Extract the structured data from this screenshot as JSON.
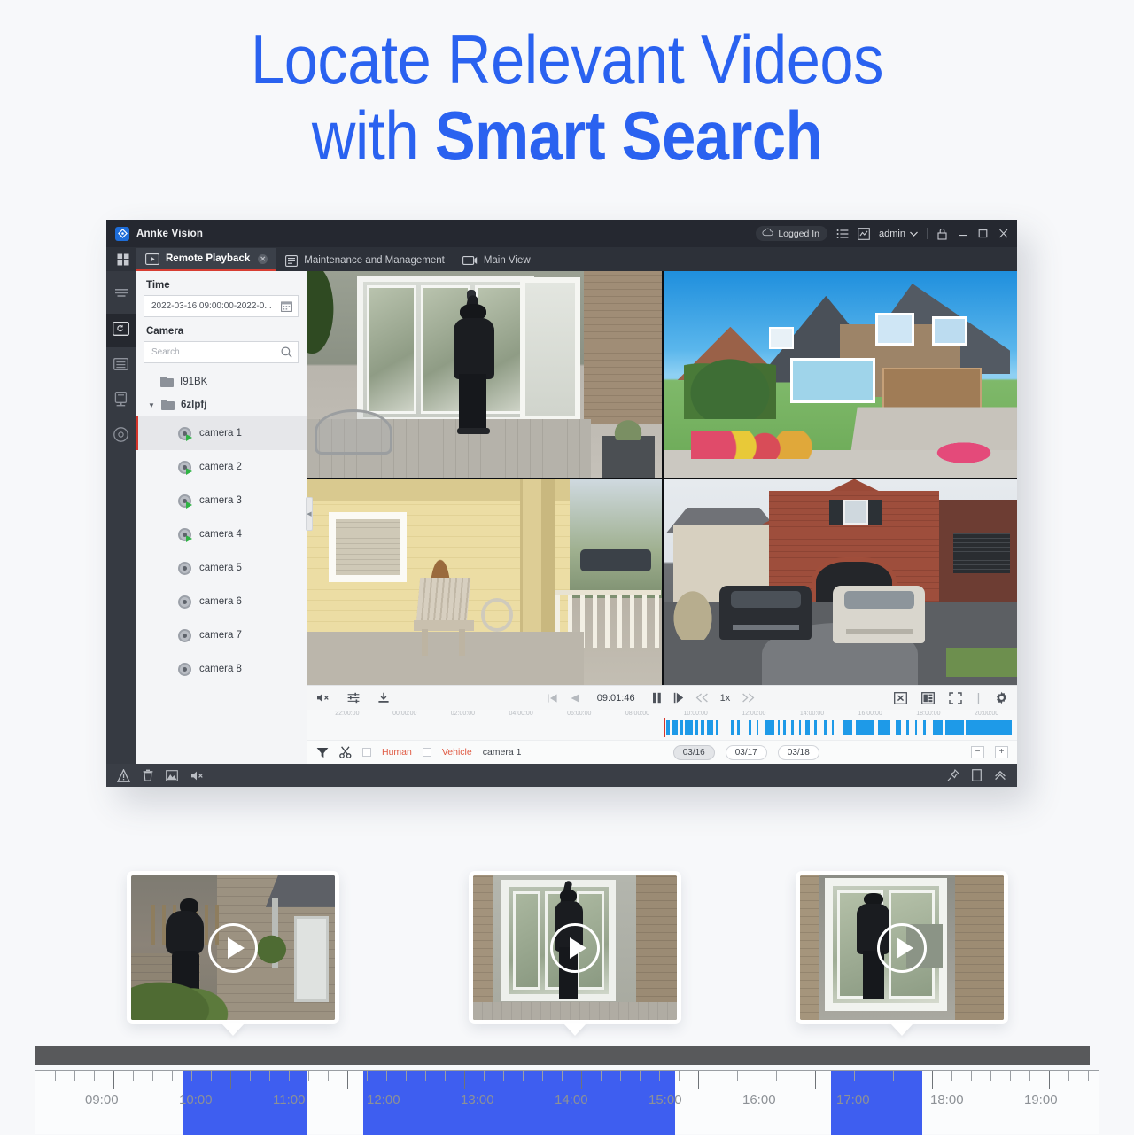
{
  "hero": {
    "line1": "Locate Relevant Videos",
    "line2_prefix": "with ",
    "line2_strong": "Smart Search",
    "color": "#2a62f0"
  },
  "app": {
    "titlebar": {
      "app_name": "Annke Vision",
      "logged_in_label": "Logged In",
      "user_label": "admin",
      "icons": {
        "cloud": "cloud-icon",
        "list": "list-icon",
        "chart": "chart-icon",
        "chevron": "chevron-down-icon",
        "lock": "lock-icon",
        "minimize": "minimize-icon",
        "maximize": "maximize-icon",
        "close": "close-icon"
      }
    },
    "tabs": [
      {
        "label": "Remote Playback",
        "active": true,
        "icon": "playback-icon",
        "closable": true
      },
      {
        "label": "Maintenance and Management",
        "active": false,
        "icon": "maintenance-icon",
        "closable": false
      },
      {
        "label": "Main View",
        "active": false,
        "icon": "monitor-icon",
        "closable": false
      }
    ],
    "rail": [
      {
        "name": "menu-icon",
        "active": false
      },
      {
        "name": "playback-icon",
        "active": true
      },
      {
        "name": "list-icon",
        "active": false
      },
      {
        "name": "device-icon",
        "active": false
      },
      {
        "name": "circle-icon",
        "active": false
      }
    ],
    "left_panel": {
      "time_label": "Time",
      "time_value": "2022-03-16 09:00:00-2022-0...",
      "calendar_icon": "calendar-icon",
      "camera_label": "Camera",
      "search_placeholder": "Search",
      "search_icon": "search-icon",
      "tree": [
        {
          "type": "folder",
          "label": "I91BK",
          "expanded": false,
          "indent": 1
        },
        {
          "type": "folder",
          "label": "6zlpfj",
          "expanded": true,
          "indent": 0
        },
        {
          "type": "camera",
          "label": "camera 1",
          "online": true,
          "selected": true
        },
        {
          "type": "camera",
          "label": "camera 2",
          "online": true,
          "selected": false
        },
        {
          "type": "camera",
          "label": "camera 3",
          "online": true,
          "selected": false
        },
        {
          "type": "camera",
          "label": "camera 4",
          "online": true,
          "selected": false
        },
        {
          "type": "camera",
          "label": "camera 5",
          "online": false,
          "selected": false
        },
        {
          "type": "camera",
          "label": "camera 6",
          "online": false,
          "selected": false
        },
        {
          "type": "camera",
          "label": "camera 7",
          "online": false,
          "selected": false
        },
        {
          "type": "camera",
          "label": "camera 8",
          "online": false,
          "selected": false
        }
      ]
    },
    "controls": {
      "mute_icon": "mute-icon",
      "adjust_icon": "sliders-icon",
      "download_icon": "download-icon",
      "frame_back_icon": "frame-back-icon",
      "prev_icon": "previous-icon",
      "current_time": "09:01:46",
      "pause_icon": "pause-icon",
      "step_icon": "step-forward-icon",
      "slower_icon": "rewind-icon",
      "speed": "1x",
      "faster_icon": "fast-forward-icon",
      "stop_all_icon": "stop-all-icon",
      "layout_icon": "layout-icon",
      "fullscreen_icon": "fullscreen-icon",
      "settings_icon": "gear-icon"
    },
    "timeline": {
      "ticks": [
        "22:00:00",
        "00:00:00",
        "02:00:00",
        "04:00:00",
        "06:00:00",
        "08:00:00",
        "10:00:00",
        "12:00:00",
        "14:00:00",
        "16:00:00",
        "18:00:00",
        "20:00:00"
      ],
      "cursor_label": "09:01:46"
    },
    "filterbar": {
      "filter_icon": "filter-icon",
      "clip_icon": "scissors-icon",
      "human_label": "Human",
      "vehicle_label": "Vehicle",
      "camera_label": "camera 1",
      "dates": [
        {
          "label": "03/16",
          "active": true
        },
        {
          "label": "03/17",
          "active": false
        },
        {
          "label": "03/18",
          "active": false
        }
      ],
      "zoom_out_label": "−",
      "zoom_in_label": "+"
    },
    "statusbar": {
      "icons": [
        "alarm-icon",
        "trash-icon",
        "screenshot-icon",
        "mute-icon"
      ],
      "right_icons": [
        "pin-icon",
        "window-icon",
        "collapse-icon"
      ]
    }
  },
  "thumbnails": [
    {
      "name": "intruder-climbing-wall",
      "play_icon": "play-icon"
    },
    {
      "name": "intruder-at-patio-door",
      "play_icon": "play-icon"
    },
    {
      "name": "intruder-entering-door",
      "play_icon": "play-icon"
    }
  ],
  "bottom_timeline": {
    "labels": [
      "09:00",
      "10:00",
      "11:00",
      "12:00",
      "13:00",
      "14:00",
      "15:00",
      "16:00",
      "17:00",
      "18:00",
      "19:00"
    ],
    "highlight_color": "#3e5ef0",
    "highlights": [
      {
        "start": "09:05",
        "end": "10:30"
      },
      {
        "start": "12:00",
        "end": "15:25"
      },
      {
        "start": "16:50",
        "end": "17:55"
      }
    ]
  }
}
